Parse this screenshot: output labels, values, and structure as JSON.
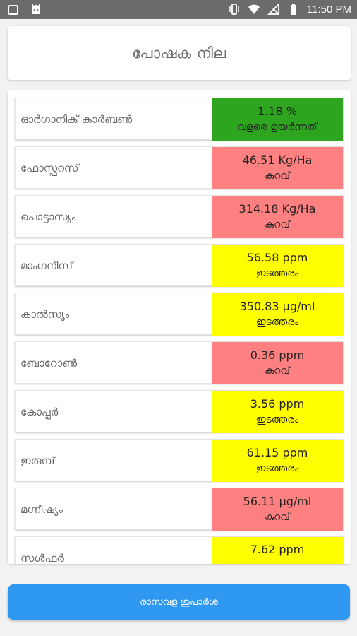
{
  "status_bar": {
    "time": "11:50 PM",
    "left_icons": [
      "notification-square-icon",
      "android-icon"
    ],
    "right_icons": [
      "vibrate-icon",
      "wifi-icon",
      "no-signal-icon",
      "battery-icon"
    ]
  },
  "header": {
    "title": "പോഷക നില"
  },
  "colors": {
    "high": "#2ea51f",
    "low": "#ff8080",
    "medium": "#ffff00",
    "button": "#2f98f1"
  },
  "nutrients": [
    {
      "name": "ഓർഗാനിക് കാർബൺ",
      "value": "1.18 %",
      "level": "വളരെ ഉയർന്നത്",
      "status": "high"
    },
    {
      "name": "ഫോസ്ഫറസ്",
      "value": "46.51 Kg/Ha",
      "level": "കുറവ്",
      "status": "low"
    },
    {
      "name": "പൊട്ടാസ്യം",
      "value": "314.18 Kg/Ha",
      "level": "കുറവ്",
      "status": "low"
    },
    {
      "name": "മാംഗനീസ്",
      "value": "56.58 ppm",
      "level": "ഇടത്തരം",
      "status": "medium"
    },
    {
      "name": "കാൽസ്യം",
      "value": "350.83 µg/ml",
      "level": "ഇടത്തരം",
      "status": "medium"
    },
    {
      "name": "ബോറോൺ",
      "value": "0.36 ppm",
      "level": "കുറവ്",
      "status": "low"
    },
    {
      "name": "കോപ്പർ",
      "value": "3.56 ppm",
      "level": "ഇടത്തരം",
      "status": "medium"
    },
    {
      "name": "ഇരുമ്പ്",
      "value": "61.15 ppm",
      "level": "ഇടത്തരം",
      "status": "medium"
    },
    {
      "name": "മഗ്നീഷ്യം",
      "value": "56.11 µg/ml",
      "level": "കുറവ്",
      "status": "low"
    },
    {
      "name": "സൾഫർ",
      "value": "7.62 ppm",
      "level": "",
      "status": "medium"
    }
  ],
  "footer": {
    "button_label": "രാസവള ശുപാർശ"
  }
}
